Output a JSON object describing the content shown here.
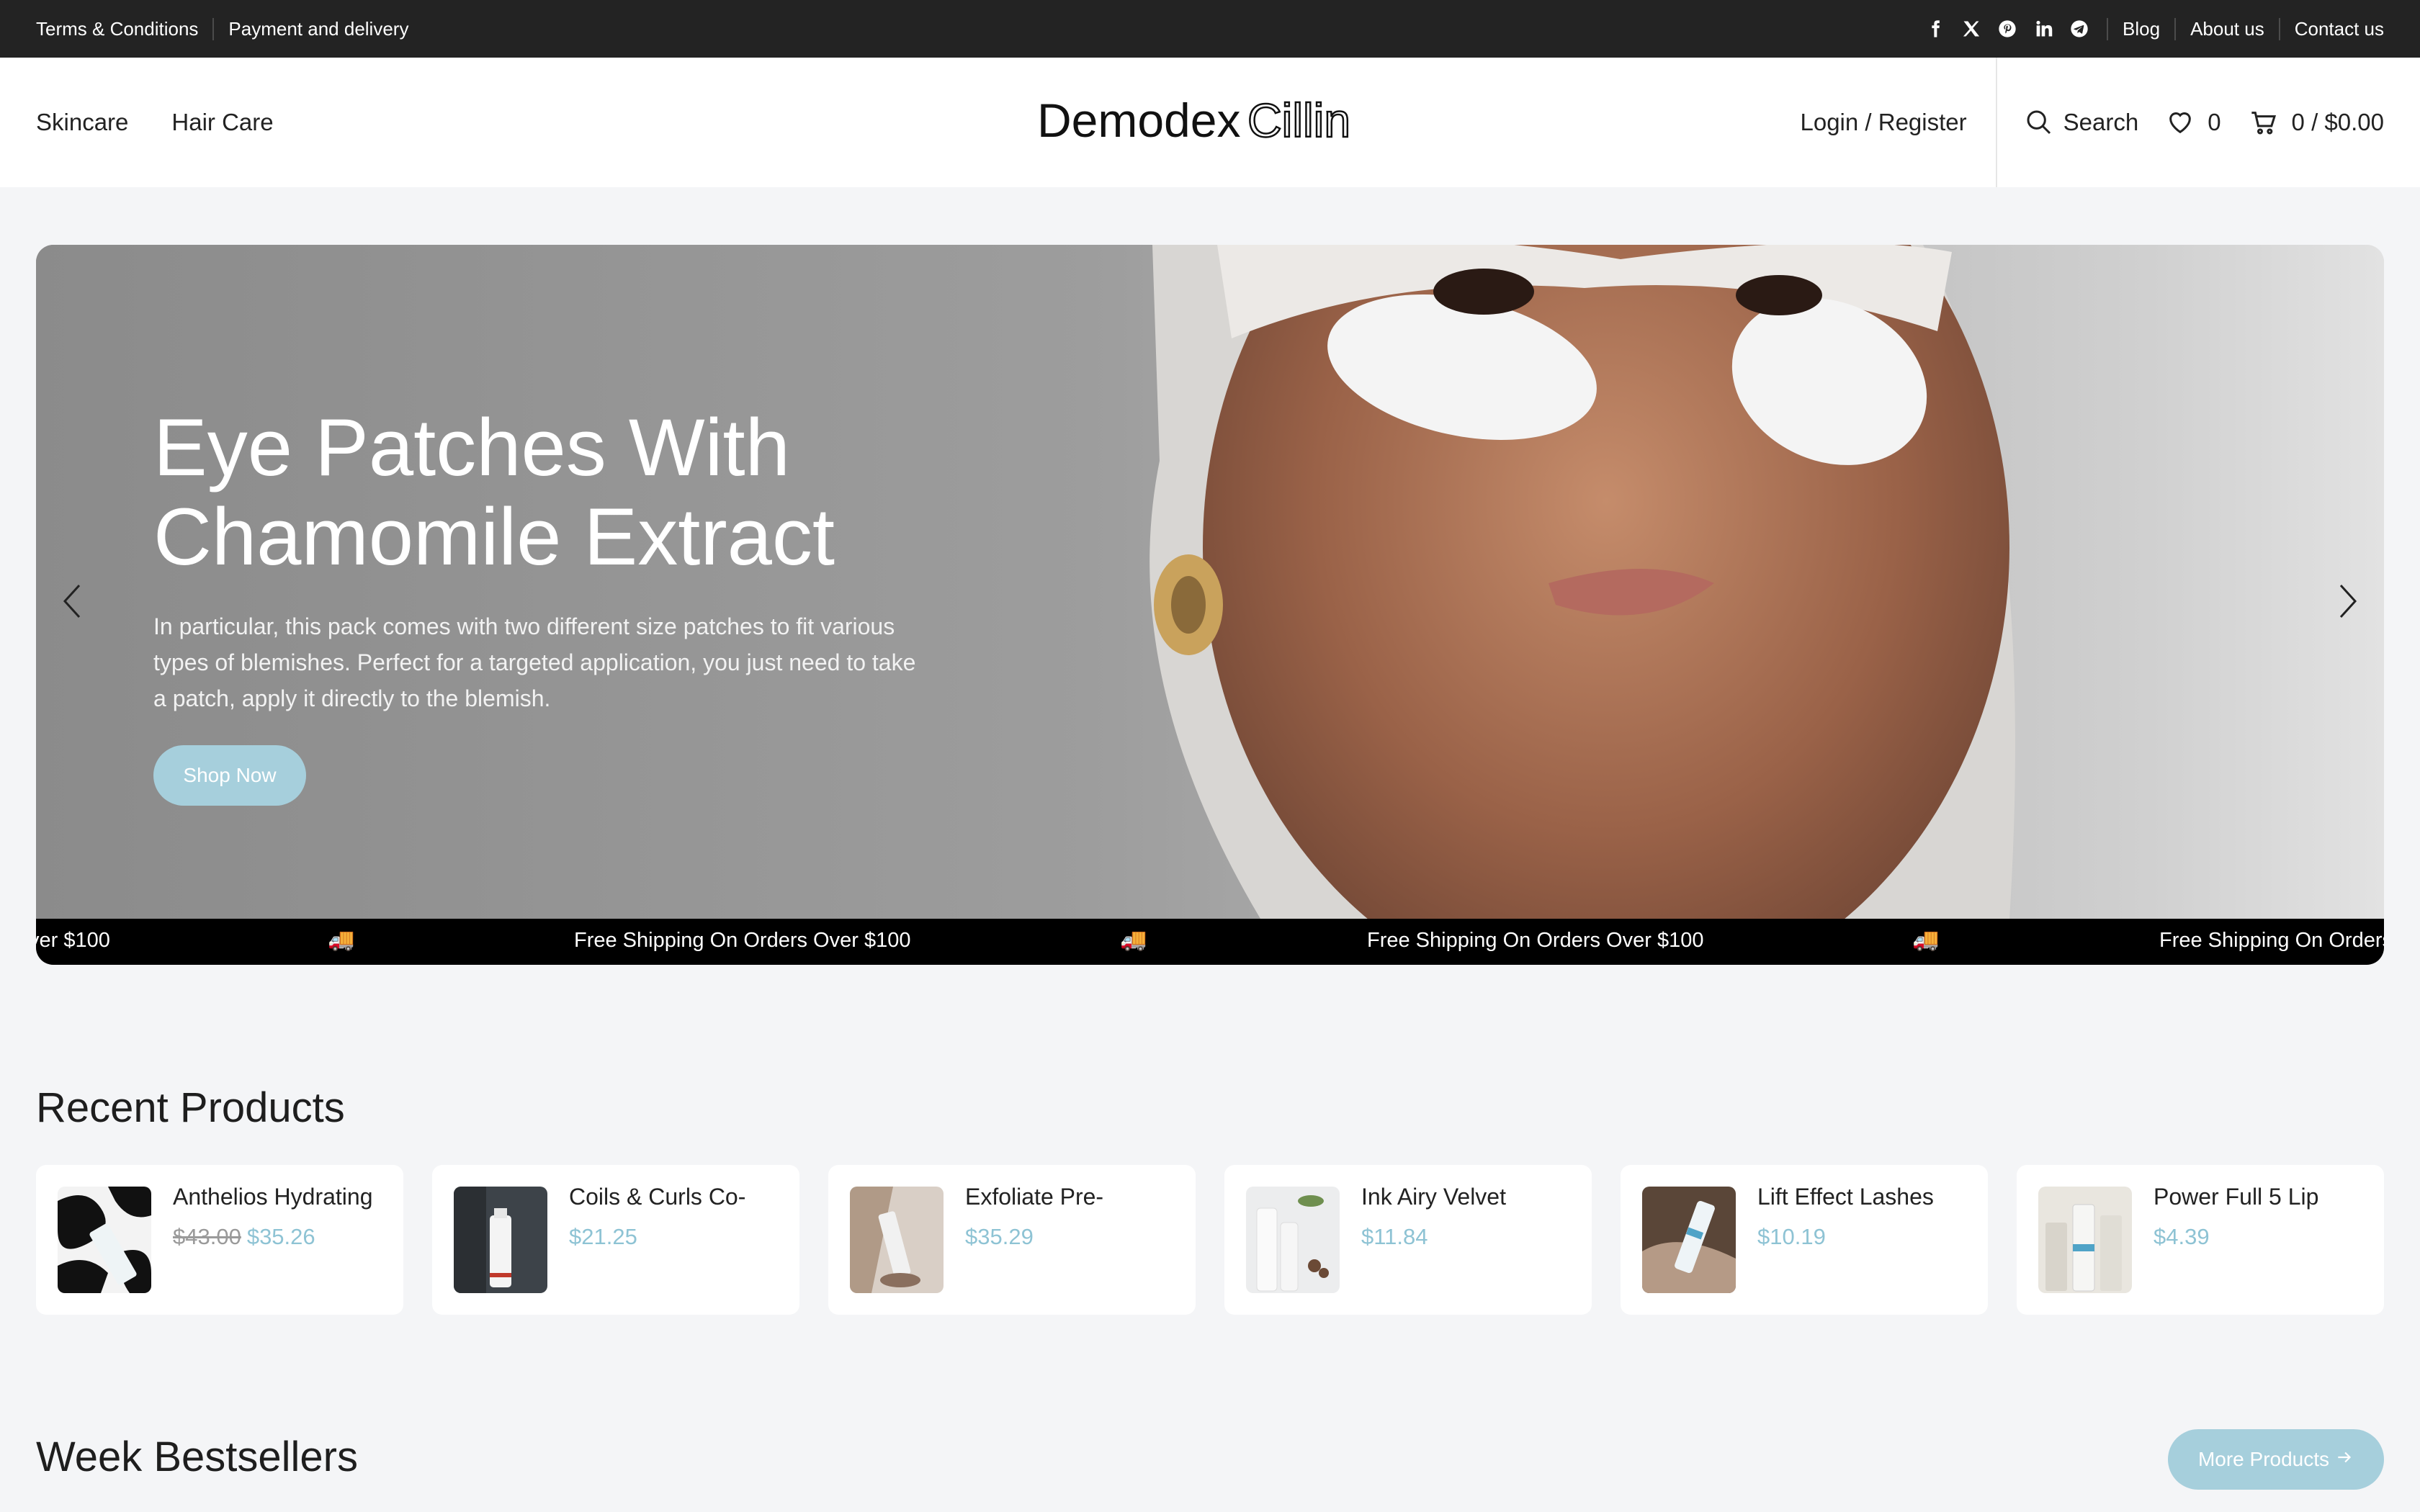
{
  "topbar": {
    "links_left": [
      "Terms & Conditions",
      "Payment and delivery"
    ],
    "social_icons": [
      "facebook-icon",
      "x-icon",
      "pinterest-icon",
      "linkedin-icon",
      "telegram-icon"
    ],
    "links_right": [
      "Blog",
      "About us",
      "Contact us"
    ]
  },
  "header": {
    "nav": [
      "Skincare",
      "Hair Care"
    ],
    "logo_text": "DemodexCillin",
    "login": "Login / Register",
    "search": "Search",
    "wishlist_count": "0",
    "cart": "0 / $0.00"
  },
  "hero": {
    "title_line1": "Eye Patches With",
    "title_line2": "Chamomile Extract",
    "description": "In particular, this pack comes with two different size patches to fit various types of blemishes. Perfect for a targeted application, you just need to take a patch, apply it directly to the blemish.",
    "button": "Shop Now",
    "ticker": [
      "ver $100",
      "Free Shipping On Orders Over $100",
      "Free Shipping On Orders Over $100",
      "Free Shipping On Orders"
    ],
    "ticker_icon": "🚚"
  },
  "recent": {
    "title": "Recent Products",
    "items": [
      {
        "name": "Anthelios Hydrating",
        "old_price": "$43.00",
        "price": "$35.26"
      },
      {
        "name": "Coils & Curls Co-",
        "old_price": "",
        "price": "$21.25"
      },
      {
        "name": "Exfoliate Pre-",
        "old_price": "",
        "price": "$35.29"
      },
      {
        "name": "Ink Airy Velvet",
        "old_price": "",
        "price": "$11.84"
      },
      {
        "name": "Lift Effect Lashes",
        "old_price": "",
        "price": "$10.19"
      },
      {
        "name": "Power Full 5 Lip",
        "old_price": "",
        "price": "$4.39"
      }
    ]
  },
  "bestsellers": {
    "title": "Week Bestsellers",
    "more_button": "More Products"
  },
  "colors": {
    "accent": "#a6cfdc",
    "price": "#8ec3d4",
    "topbar": "#232323"
  }
}
